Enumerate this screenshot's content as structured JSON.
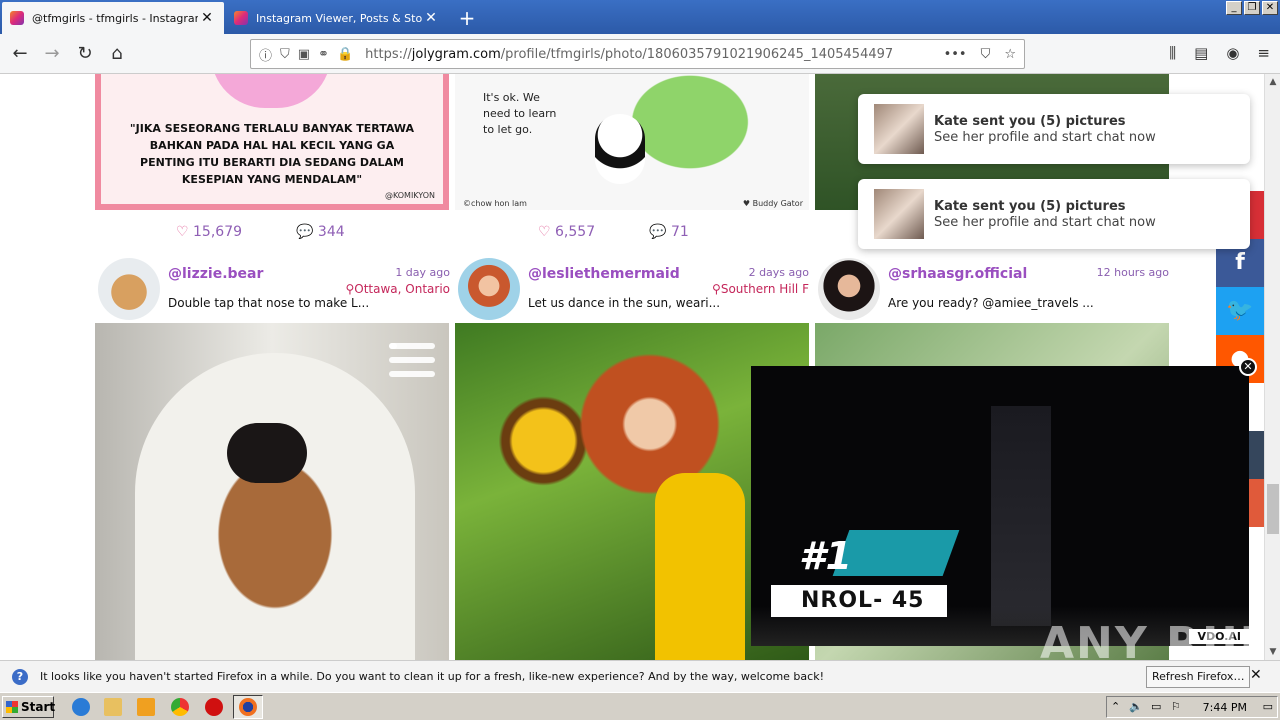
{
  "browser": {
    "tabs": [
      {
        "title": "@tfmgirls - tfmgirls - Instagram Po",
        "active": true
      },
      {
        "title": "Instagram Viewer, Posts & Story ",
        "active": false
      }
    ],
    "url_prefix": "https://",
    "url_domain": "jolygram.com",
    "url_path": "/profile/tfmgirls/photo/1806035791021906245_1405454497",
    "accent_color": "#2c5aa8"
  },
  "cards": {
    "quote1": {
      "text": "\"JIKA SESEORANG TERLALU BANYAK TERTAWA BAHKAN PADA HAL HAL KECIL YANG GA PENTING ITU BERARTI DIA SEDANG DALAM KESEPIAN YANG MENDALAM\"",
      "credit": "@KOMIKYON",
      "likes": "15,679",
      "comments": "344"
    },
    "quote2": {
      "text_line1": "It's ok. We",
      "text_line2": "need to learn",
      "text_line3": "to let go.",
      "credit": "©chow hon lam",
      "credit2": "♥ Buddy Gator",
      "likes": "6,557",
      "comments": "71"
    }
  },
  "posts": [
    {
      "handle": "@lizzie.bear",
      "time": "1 day ago",
      "location": "Ottawa, Ontario",
      "caption": "Double tap that nose to make L..."
    },
    {
      "handle": "@lesliethemermaid",
      "time": "2 days ago",
      "location": "Southern Hill F",
      "caption": "Let us dance in the sun, weari..."
    },
    {
      "handle": "@srhaasgr.official",
      "time": "12 hours ago",
      "location": "",
      "caption": "Are you ready? @amiee_travels ..."
    }
  ],
  "notifications": [
    {
      "title": "Kate sent you (5) pictures",
      "subtitle": "See her profile and start chat now"
    },
    {
      "title": "Kate sent you (5) pictures",
      "subtitle": "See her profile and start chat now"
    }
  ],
  "video": {
    "rank": "#1",
    "label": "NROL- 45",
    "brand": "VDO.AI"
  },
  "watermark": "ANY RUN",
  "infobar": {
    "message": "It looks like you haven't started Firefox in a while. Do you want to clean it up for a fresh, like-new experience? And by the way, welcome back!",
    "button": "Refresh Firefox…"
  },
  "taskbar": {
    "start": "Start",
    "clock": "7:44 PM"
  }
}
